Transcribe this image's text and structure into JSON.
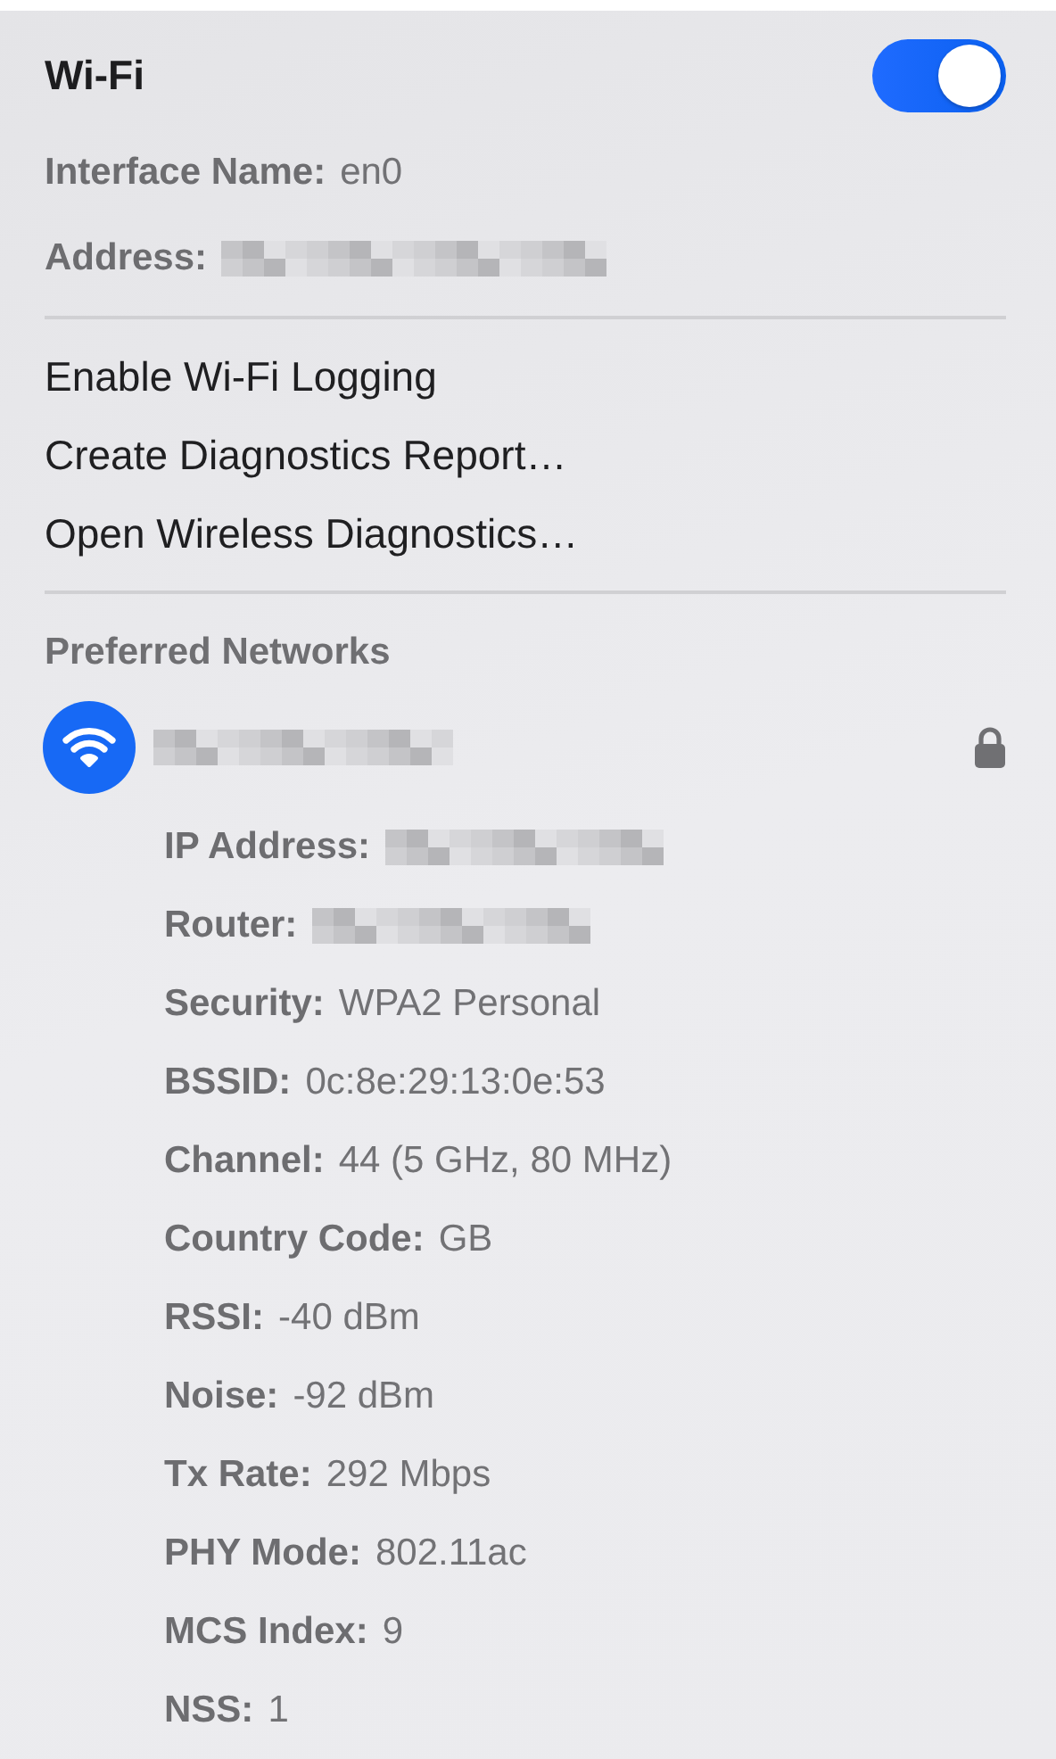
{
  "header": {
    "title": "Wi-Fi",
    "toggle": {
      "on": true
    }
  },
  "interface_info": [
    {
      "label": "Interface Name:",
      "value": "en0",
      "redacted": false
    },
    {
      "label": "Address:",
      "redacted": true
    }
  ],
  "menu_items": [
    "Enable Wi-Fi Logging",
    "Create Diagnostics Report…",
    "Open Wireless Diagnostics…"
  ],
  "preferred_networks": {
    "heading": "Preferred Networks",
    "networks": [
      {
        "name_redacted": true,
        "locked": true,
        "details": [
          {
            "label": "IP Address:",
            "redacted": true
          },
          {
            "label": "Router:",
            "redacted": true
          },
          {
            "label": "Security:",
            "value": "WPA2 Personal",
            "redacted": false
          },
          {
            "label": "BSSID:",
            "value": "0c:8e:29:13:0e:53",
            "redacted": false
          },
          {
            "label": "Channel:",
            "value": "44 (5 GHz, 80 MHz)",
            "redacted": false
          },
          {
            "label": "Country Code:",
            "value": "GB",
            "redacted": false
          },
          {
            "label": "RSSI:",
            "value": "-40 dBm",
            "redacted": false
          },
          {
            "label": "Noise:",
            "value": "-92 dBm",
            "redacted": false
          },
          {
            "label": "Tx Rate:",
            "value": "292 Mbps",
            "redacted": false
          },
          {
            "label": "PHY Mode:",
            "value": "802.11ac",
            "redacted": false
          },
          {
            "label": "MCS Index:",
            "value": "9",
            "redacted": false
          },
          {
            "label": "NSS:",
            "value": "1",
            "redacted": false
          }
        ]
      }
    ]
  }
}
